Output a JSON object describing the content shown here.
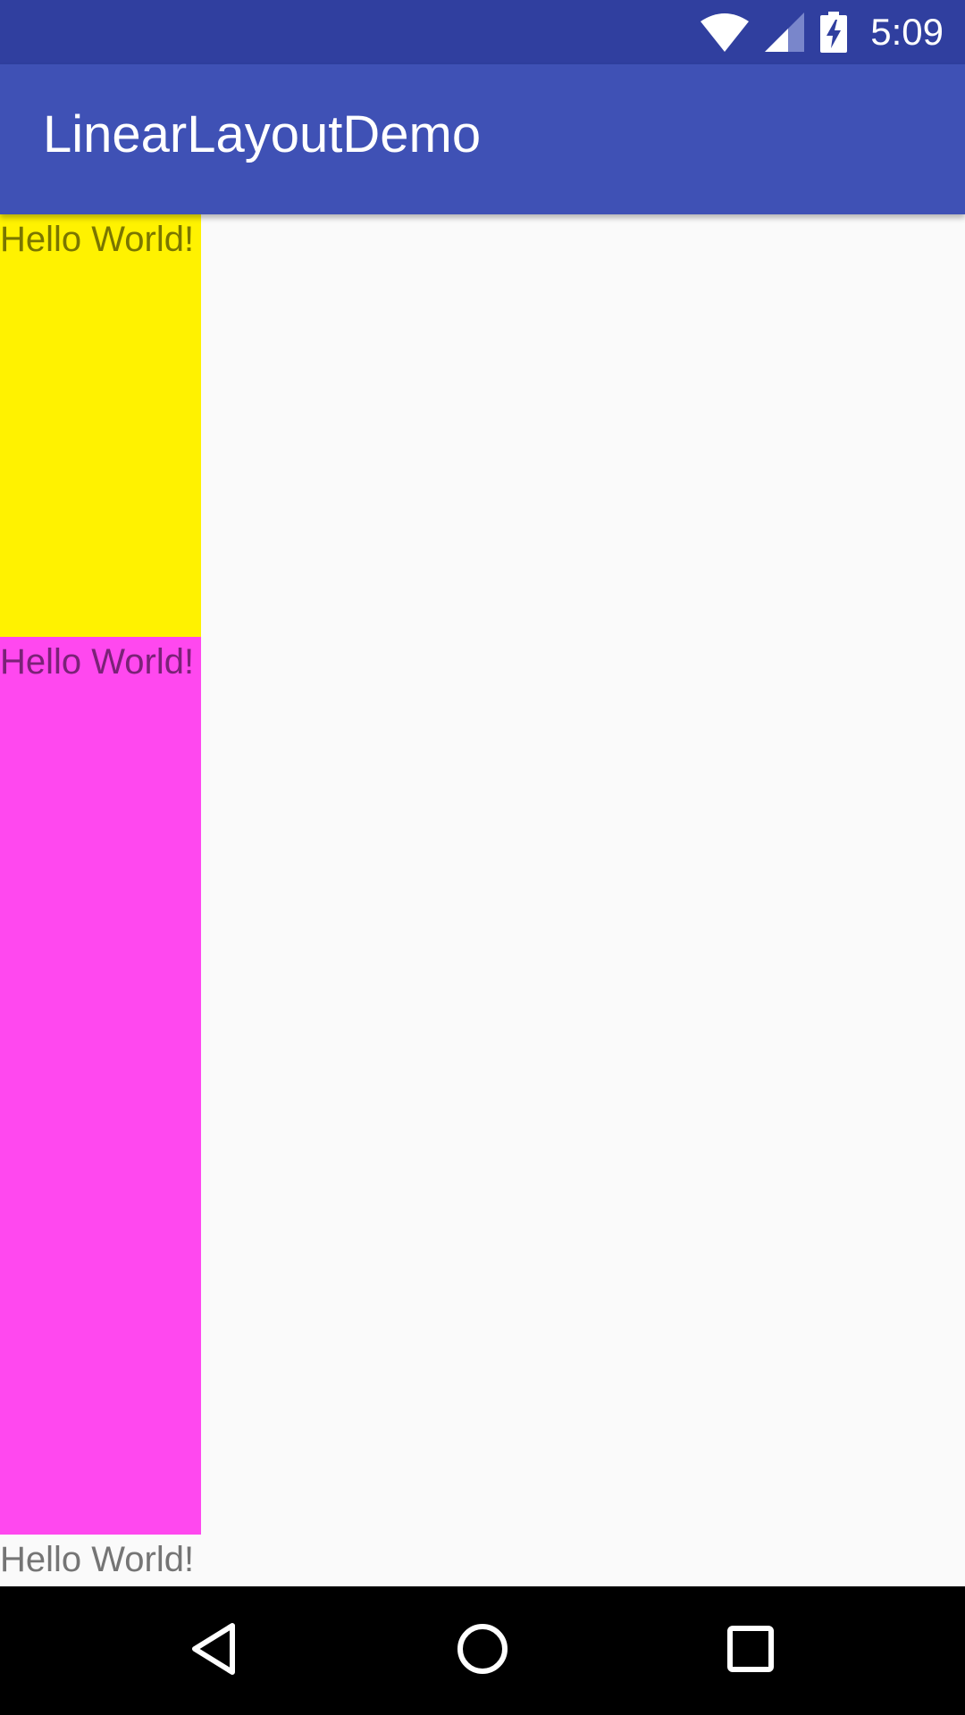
{
  "status_bar": {
    "time": "5:09",
    "icons": [
      "wifi-icon",
      "cell-signal-icon",
      "battery-charging-icon"
    ]
  },
  "app_bar": {
    "title": "LinearLayoutDemo"
  },
  "content": {
    "texts": [
      {
        "label": "Hello World!",
        "background": "#fff200"
      },
      {
        "label": "Hello World!",
        "background": "#ff48ef"
      },
      {
        "label": "Hello World!",
        "background": "#fafafa"
      }
    ]
  },
  "nav_bar": {
    "buttons": [
      "back-icon",
      "home-icon",
      "recents-icon"
    ]
  },
  "colors": {
    "status_bar": "#303f9f",
    "app_bar": "#3f51b5",
    "yellow": "#fff200",
    "magenta": "#ff48ef"
  }
}
